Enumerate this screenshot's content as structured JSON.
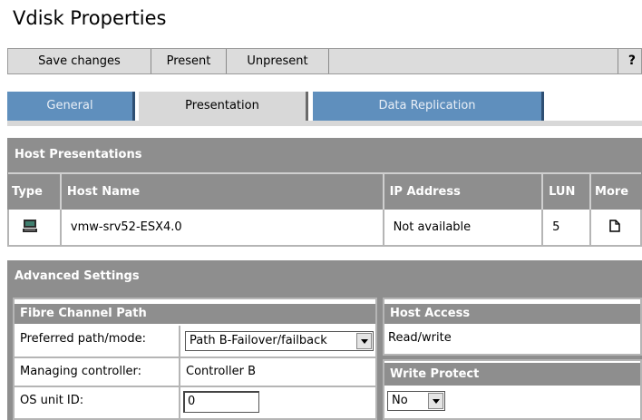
{
  "page": {
    "title": "Vdisk Properties"
  },
  "toolbar": {
    "buttons": [
      {
        "label": "Save changes"
      },
      {
        "label": "Present"
      },
      {
        "label": "Unpresent"
      }
    ],
    "help_label": "?"
  },
  "tabs": [
    {
      "label": "General",
      "state": "inactive"
    },
    {
      "label": "Presentation",
      "state": "active"
    },
    {
      "label": "Data Replication",
      "state": "inactive"
    }
  ],
  "host_presentations": {
    "title": "Host Presentations",
    "columns": [
      "Type",
      "Host Name",
      "IP Address",
      "LUN",
      "More"
    ],
    "rows": [
      {
        "type_icon": "host-computer-icon",
        "host_name": "vmw-srv52-ESX4.0",
        "ip_address": "Not available",
        "lun": "5",
        "more_icon": "document-icon"
      }
    ]
  },
  "advanced_settings": {
    "title": "Advanced Settings",
    "fibre_channel_path": {
      "title": "Fibre Channel Path",
      "preferred_path_label": "Preferred path/mode:",
      "preferred_path_value": "Path B-Failover/failback",
      "managing_controller_label": "Managing controller:",
      "managing_controller_value": "Controller B",
      "os_unit_id_label": "OS unit ID:",
      "os_unit_id_value": "0"
    },
    "host_access": {
      "title": "Host Access",
      "value": "Read/write"
    },
    "write_protect": {
      "title": "Write Protect",
      "value": "No"
    }
  },
  "colors": {
    "tab_inactive": "#5f8fbd",
    "tab_active": "#d8d8d8",
    "section_header": "#8e8e8e",
    "toolbar": "#dcdcdc"
  }
}
